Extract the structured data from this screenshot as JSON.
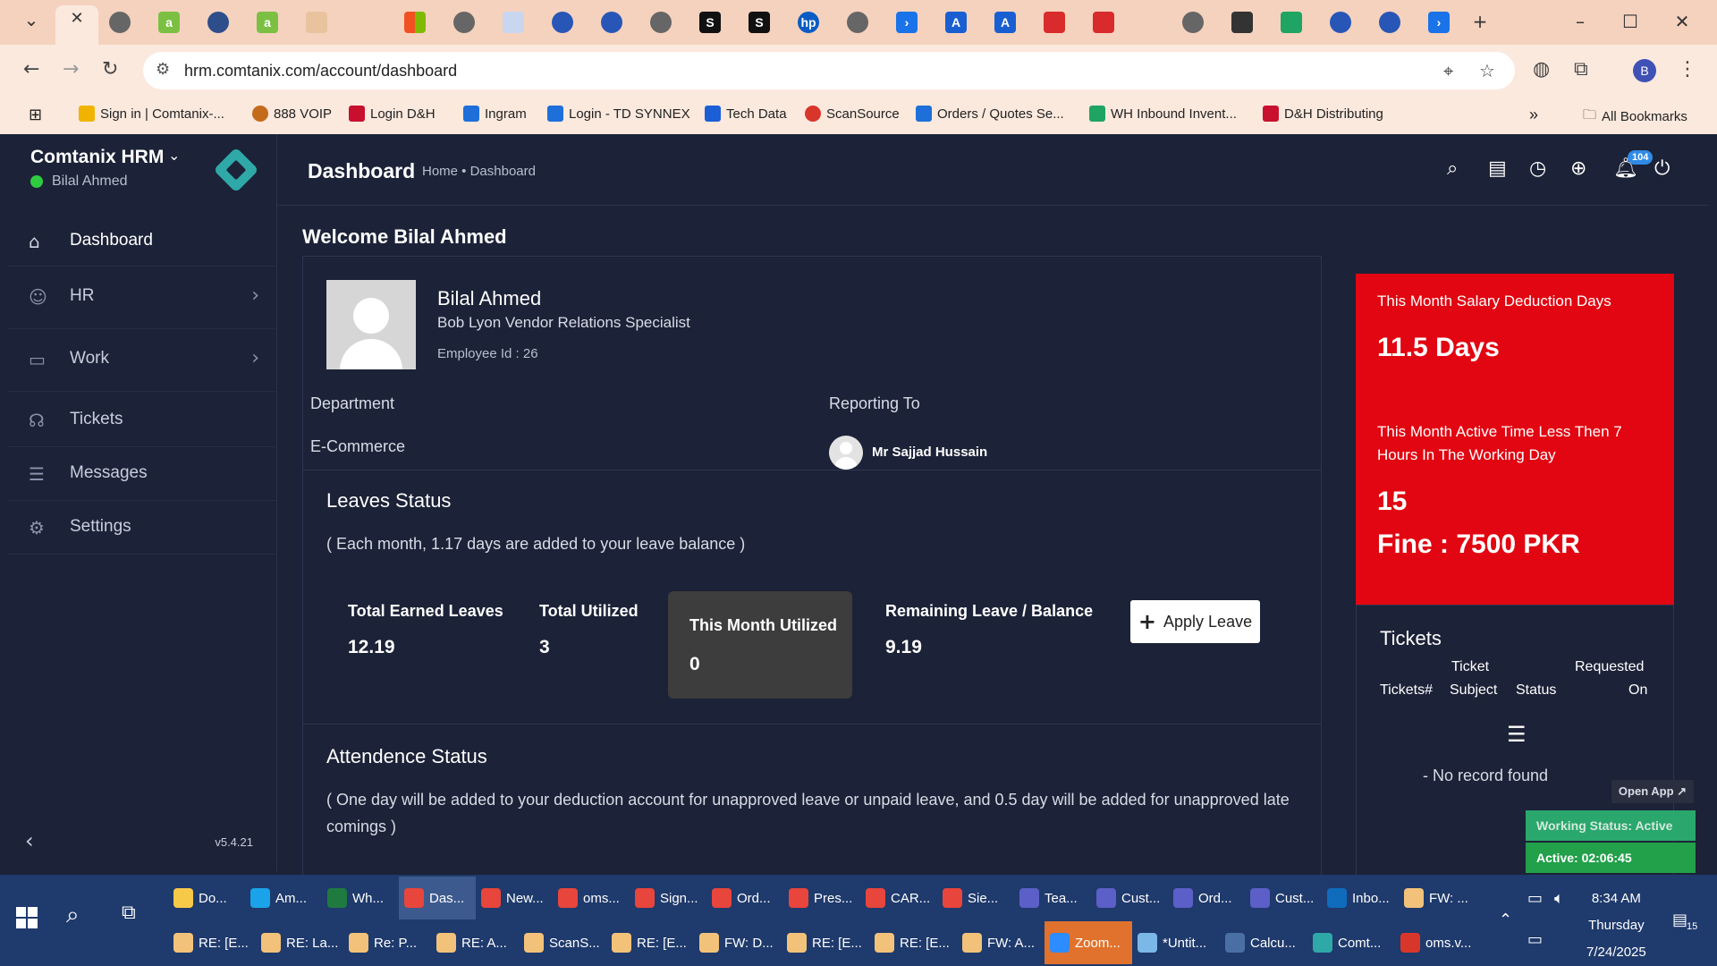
{
  "browser": {
    "url": "hrm.comtanix.com/account/dashboard",
    "bookmarks": [
      {
        "label": "Sign in | Comtanix-...",
        "icon": "bookmark-comtanix-icon",
        "color": "#f0b400"
      },
      {
        "label": "888 VOIP",
        "icon": "bookmark-voip-icon",
        "color": "#c46a1b"
      },
      {
        "label": "Login D&H",
        "icon": "bookmark-dh-icon",
        "color": "#c8102e"
      },
      {
        "label": "Ingram",
        "icon": "bookmark-ingram-icon",
        "color": "#1e6fd9"
      },
      {
        "label": "Login - TD SYNNEX",
        "icon": "bookmark-tdsynnex-icon",
        "color": "#1e6fd9"
      },
      {
        "label": "Tech Data",
        "icon": "bookmark-techdata-icon",
        "color": "#1c5ed6"
      },
      {
        "label": "ScanSource",
        "icon": "bookmark-scansource-icon",
        "color": "#d9362b"
      },
      {
        "label": "Orders / Quotes Se...",
        "icon": "bookmark-orders-icon",
        "color": "#1e6fd9"
      },
      {
        "label": "WH Inbound Invent...",
        "icon": "bookmark-sheets-icon",
        "color": "#1fa463"
      },
      {
        "label": "D&H Distributing",
        "icon": "bookmark-dh-distributing-icon",
        "color": "#c8102e"
      }
    ],
    "all_bookmarks": "All Bookmarks",
    "profile_initial": "B"
  },
  "app": {
    "brand": "Comtanix HRM",
    "user": "Bilal Ahmed",
    "version": "v5.4.21",
    "nav": [
      {
        "label": "Dashboard",
        "icon": "home-icon"
      },
      {
        "label": "HR",
        "icon": "users-icon"
      },
      {
        "label": "Work",
        "icon": "briefcase-icon"
      },
      {
        "label": "Tickets",
        "icon": "headset-icon"
      },
      {
        "label": "Messages",
        "icon": "message-icon"
      },
      {
        "label": "Settings",
        "icon": "gear-icon"
      }
    ],
    "page_title": "Dashboard",
    "breadcrumb": "Home • Dashboard",
    "notification_count": "104"
  },
  "dashboard": {
    "welcome": "Welcome Bilal Ahmed",
    "employee": {
      "name": "Bilal Ahmed",
      "title": "Bob Lyon Vendor Relations Specialist",
      "employee_id": "Employee Id : 26",
      "department_label": "Department",
      "department": "E-Commerce",
      "reporting_label": "Reporting To",
      "reporting_to": "Mr Sajjad Hussain"
    },
    "leaves": {
      "title": "Leaves Status",
      "note": "( Each month, 1.17 days are added to your leave balance )",
      "total_earned_label": "Total Earned Leaves",
      "total_earned": "12.19",
      "total_utilized_label": "Total Utilized",
      "total_utilized": "3",
      "month_utilized_label": "This Month Utilized",
      "month_utilized": "0",
      "remaining_label": "Remaining Leave / Balance",
      "remaining": "9.19",
      "apply_button": "Apply Leave"
    },
    "attendance": {
      "title": "Attendence Status",
      "note": "( One day will be added to your deduction account for unapproved leave or unpaid leave, and 0.5 day will be added for unapproved late comings )"
    },
    "deduction": {
      "salary_label": "This Month Salary Deduction Days",
      "salary_days": "11.5 Days",
      "active_label": "This Month Active Time Less Then 7 Hours In The Working Day",
      "active_days": "15",
      "fine": "Fine : 7500 PKR"
    },
    "tickets": {
      "title": "Tickets",
      "col1": "Tickets#",
      "col2_line1": "Ticket",
      "col2_line2": "Subject",
      "col3": "Status",
      "col4_line1": "Requested",
      "col4_line2": "On",
      "empty": "- No record found"
    }
  },
  "widget": {
    "open_app": "Open App ↗",
    "working_status": "Working Status: Active",
    "active_time": "Active: 02:06:45"
  },
  "taskbar": {
    "row1": [
      {
        "label": "Do...",
        "color": "#f7c948"
      },
      {
        "label": "Am...",
        "color": "#1aa3e8"
      },
      {
        "label": "Wh...",
        "color": "#1f7a3f"
      },
      {
        "label": "Das...",
        "color": "#e8453c",
        "active": true
      },
      {
        "label": "New...",
        "color": "#e8453c"
      },
      {
        "label": "oms...",
        "color": "#e8453c"
      },
      {
        "label": "Sign...",
        "color": "#e8453c"
      },
      {
        "label": "Ord...",
        "color": "#e8453c"
      },
      {
        "label": "Pres...",
        "color": "#e8453c"
      },
      {
        "label": "CAR...",
        "color": "#e8453c"
      },
      {
        "label": "Sie...",
        "color": "#e8453c"
      },
      {
        "label": "Tea...",
        "color": "#5b5fc7"
      },
      {
        "label": "Cust...",
        "color": "#5b5fc7"
      },
      {
        "label": "Ord...",
        "color": "#5b5fc7"
      },
      {
        "label": "Cust...",
        "color": "#5b5fc7"
      },
      {
        "label": "Inbo...",
        "color": "#0f6cbd"
      },
      {
        "label": "FW: ...",
        "color": "#f2c27a"
      }
    ],
    "row2": [
      {
        "label": "RE: [E...",
        "color": "#f2c27a"
      },
      {
        "label": "RE: La...",
        "color": "#f2c27a"
      },
      {
        "label": "Re: P...",
        "color": "#f2c27a"
      },
      {
        "label": "RE: A...",
        "color": "#f2c27a"
      },
      {
        "label": "ScanS...",
        "color": "#f2c27a"
      },
      {
        "label": "RE: [E...",
        "color": "#f2c27a"
      },
      {
        "label": "FW: D...",
        "color": "#f2c27a"
      },
      {
        "label": "RE: [E...",
        "color": "#f2c27a"
      },
      {
        "label": "RE: [E...",
        "color": "#f2c27a"
      },
      {
        "label": "FW: A...",
        "color": "#f2c27a"
      },
      {
        "label": "Zoom...",
        "color": "#2d8cff",
        "zoom": true
      },
      {
        "label": "*Untit...",
        "color": "#7ab8e8"
      },
      {
        "label": "Calcu...",
        "color": "#4a6fa5"
      },
      {
        "label": "Comt...",
        "color": "#2fa8a8"
      },
      {
        "label": "oms.v...",
        "color": "#d9362b"
      }
    ],
    "time": "8:34 AM",
    "day": "Thursday",
    "date": "7/24/2025",
    "notifications": "15"
  }
}
